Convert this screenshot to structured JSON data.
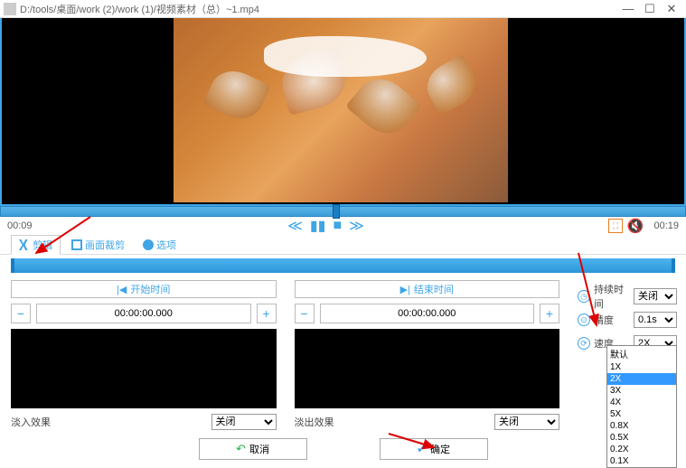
{
  "window": {
    "title": "D:/tools/桌面/work (2)/work (1)/视频素材（总）~1.mp4"
  },
  "playback": {
    "current": "00:09",
    "total": "00:19"
  },
  "tabs": {
    "trim": "剪辑",
    "crop": "画面裁剪",
    "options": "选项"
  },
  "panels": {
    "start_btn": "开始时间",
    "end_btn": "结束时间",
    "start_time": "00:00:00.000",
    "end_time": "00:00:00.000",
    "fade_in_label": "淡入效果",
    "fade_out_label": "淡出效果",
    "effect_value": "关闭"
  },
  "side": {
    "duration_label": "持续时间",
    "duration_value": "关闭",
    "precision_label": "精度",
    "precision_value": "0.1s",
    "speed_label": "速度",
    "speed_value": "2X"
  },
  "speed_options": [
    "默认",
    "1X",
    "2X",
    "3X",
    "4X",
    "5X",
    "0.8X",
    "0.5X",
    "0.2X",
    "0.1X"
  ],
  "buttons": {
    "cancel": "取消",
    "ok": "确定"
  }
}
